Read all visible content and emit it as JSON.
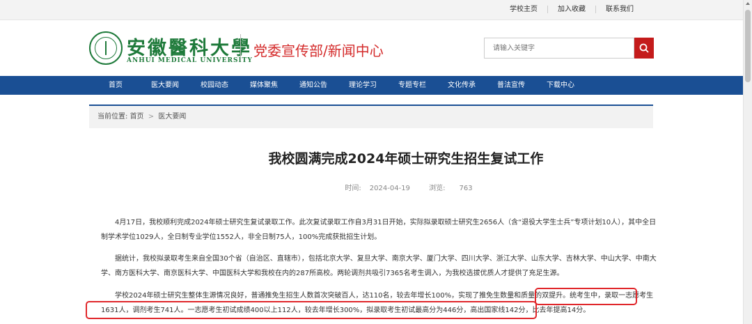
{
  "top_links": [
    "学校主页",
    "加入收藏",
    "联系我们"
  ],
  "logo": {
    "chinese_name": "安徽醫科大學",
    "english_name": "ANHUI MEDICAL UNIVERSITY"
  },
  "site_name": "党委宣传部/新闻中心",
  "search": {
    "placeholder": "请输入关键字"
  },
  "nav": [
    "首页",
    "医大要闻",
    "校园动态",
    "媒体聚焦",
    "通知公告",
    "理论学习",
    "专题专栏",
    "文化传承",
    "普法宣传",
    "下载中心"
  ],
  "breadcrumb": {
    "label": "当前位置:",
    "home": "首页",
    "separator": ">",
    "current": "医大要闻"
  },
  "article": {
    "title": "我校圆满完成2024年硕士研究生招生复试工作",
    "time_label": "时间:",
    "date": "2024-04-19",
    "views_label": "浏览:",
    "views": "763",
    "paragraphs": [
      "4月17日，我校顺利完成2024年硕士研究生复试录取工作。此次复试录取工作自3月31日开始，实际拟录取硕士研究生2656人（含“退役大学生士兵”专项计划10人），其中全日制学术学位1029人，全日制专业学位1552人，非全日制75人，100%完成获批招生计划。",
      "据统计，我校拟录取考生来自全国30个省（自治区、直辖市），包括北京大学、复旦大学、南京大学、厦门大学、四川大学、浙江大学、山东大学、吉林大学、中山大学、中南大学、南方医科大学、南京医科大学、中国医科大学和我校在内的287所高校。两轮调剂共吸引7365名考生调入，为我校选拔优质人才提供了充足生源。",
      "学校2024年硕士研究生整体生源情况良好，普通推免生招生人数首次突破百人，达110名，较去年增长100%，实现了推免生数量和质量的双提升。统考生中，录取一志愿考生1631人，调剂考生741人。一志愿考生初试成绩400以上112人，较去年增长300%，拟录取考生初试最高分为446分，高出国家线142分，比去年提高14分。"
    ]
  }
}
